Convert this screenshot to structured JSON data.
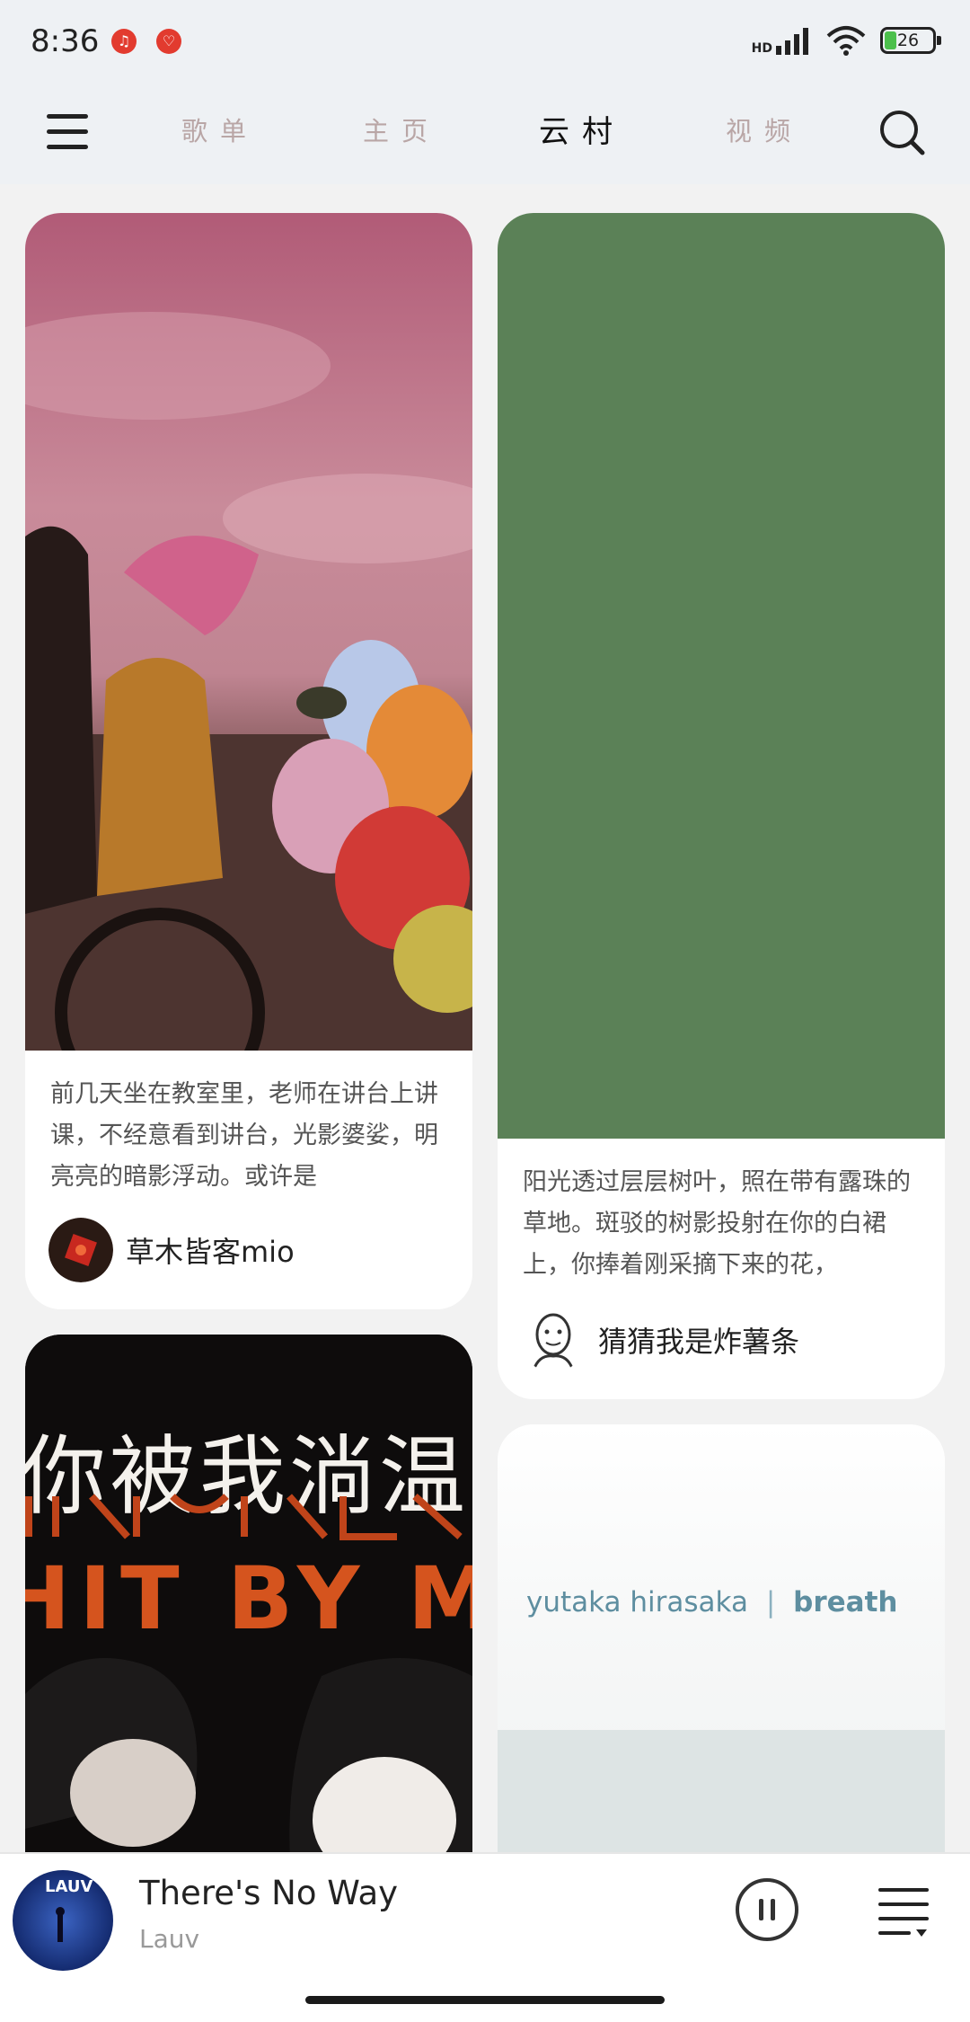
{
  "status_bar": {
    "time": "8:36",
    "network_label": "HD",
    "battery": "26"
  },
  "nav": {
    "tabs": [
      {
        "label": "歌单",
        "active": false
      },
      {
        "label": "主页",
        "active": false
      },
      {
        "label": "云村",
        "active": true
      },
      {
        "label": "视频",
        "active": false
      }
    ]
  },
  "feed": {
    "cards": [
      {
        "description": "前几天坐在教室里，老师在讲台上讲课，不经意看到讲台，光影婆娑，明亮亮的暗影浮动。或许是",
        "author": "草木皆客mio"
      },
      {
        "description": "阳光透过层层树叶，照在带有露珠的草地。斑驳的树影投射在你的白裙上，你捧着刚采摘下来的花，",
        "author": "猜猜我是炸薯条"
      },
      {
        "image_text": [
          "你被我淌温",
          "HIT BY ME"
        ]
      },
      {
        "image_text": [
          "yutaka hirasaka",
          "breath"
        ]
      }
    ]
  },
  "player": {
    "song": "There's No Way",
    "artist": "Lauv",
    "cover_text": "LAUV"
  },
  "colors": {
    "green_card": "#5b8157",
    "notif_red": "#e23b2f",
    "tab_inactive": "#b9a6a6",
    "poster_orange": "#d5541e"
  }
}
